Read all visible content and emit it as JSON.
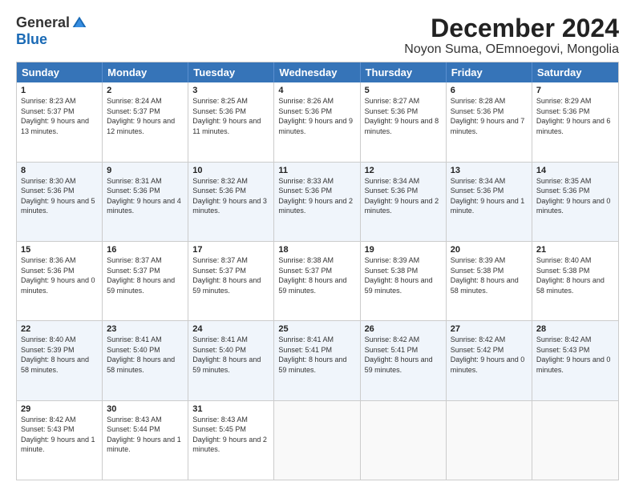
{
  "logo": {
    "general": "General",
    "blue": "Blue"
  },
  "title": "December 2024",
  "subtitle": "Noyon Suma, OEmnoegovi, Mongolia",
  "header_days": [
    "Sunday",
    "Monday",
    "Tuesday",
    "Wednesday",
    "Thursday",
    "Friday",
    "Saturday"
  ],
  "weeks": [
    [
      {
        "day": "1",
        "sunrise": "Sunrise: 8:23 AM",
        "sunset": "Sunset: 5:37 PM",
        "daylight": "Daylight: 9 hours and 13 minutes."
      },
      {
        "day": "2",
        "sunrise": "Sunrise: 8:24 AM",
        "sunset": "Sunset: 5:37 PM",
        "daylight": "Daylight: 9 hours and 12 minutes."
      },
      {
        "day": "3",
        "sunrise": "Sunrise: 8:25 AM",
        "sunset": "Sunset: 5:36 PM",
        "daylight": "Daylight: 9 hours and 11 minutes."
      },
      {
        "day": "4",
        "sunrise": "Sunrise: 8:26 AM",
        "sunset": "Sunset: 5:36 PM",
        "daylight": "Daylight: 9 hours and 9 minutes."
      },
      {
        "day": "5",
        "sunrise": "Sunrise: 8:27 AM",
        "sunset": "Sunset: 5:36 PM",
        "daylight": "Daylight: 9 hours and 8 minutes."
      },
      {
        "day": "6",
        "sunrise": "Sunrise: 8:28 AM",
        "sunset": "Sunset: 5:36 PM",
        "daylight": "Daylight: 9 hours and 7 minutes."
      },
      {
        "day": "7",
        "sunrise": "Sunrise: 8:29 AM",
        "sunset": "Sunset: 5:36 PM",
        "daylight": "Daylight: 9 hours and 6 minutes."
      }
    ],
    [
      {
        "day": "8",
        "sunrise": "Sunrise: 8:30 AM",
        "sunset": "Sunset: 5:36 PM",
        "daylight": "Daylight: 9 hours and 5 minutes."
      },
      {
        "day": "9",
        "sunrise": "Sunrise: 8:31 AM",
        "sunset": "Sunset: 5:36 PM",
        "daylight": "Daylight: 9 hours and 4 minutes."
      },
      {
        "day": "10",
        "sunrise": "Sunrise: 8:32 AM",
        "sunset": "Sunset: 5:36 PM",
        "daylight": "Daylight: 9 hours and 3 minutes."
      },
      {
        "day": "11",
        "sunrise": "Sunrise: 8:33 AM",
        "sunset": "Sunset: 5:36 PM",
        "daylight": "Daylight: 9 hours and 2 minutes."
      },
      {
        "day": "12",
        "sunrise": "Sunrise: 8:34 AM",
        "sunset": "Sunset: 5:36 PM",
        "daylight": "Daylight: 9 hours and 2 minutes."
      },
      {
        "day": "13",
        "sunrise": "Sunrise: 8:34 AM",
        "sunset": "Sunset: 5:36 PM",
        "daylight": "Daylight: 9 hours and 1 minute."
      },
      {
        "day": "14",
        "sunrise": "Sunrise: 8:35 AM",
        "sunset": "Sunset: 5:36 PM",
        "daylight": "Daylight: 9 hours and 0 minutes."
      }
    ],
    [
      {
        "day": "15",
        "sunrise": "Sunrise: 8:36 AM",
        "sunset": "Sunset: 5:36 PM",
        "daylight": "Daylight: 9 hours and 0 minutes."
      },
      {
        "day": "16",
        "sunrise": "Sunrise: 8:37 AM",
        "sunset": "Sunset: 5:37 PM",
        "daylight": "Daylight: 8 hours and 59 minutes."
      },
      {
        "day": "17",
        "sunrise": "Sunrise: 8:37 AM",
        "sunset": "Sunset: 5:37 PM",
        "daylight": "Daylight: 8 hours and 59 minutes."
      },
      {
        "day": "18",
        "sunrise": "Sunrise: 8:38 AM",
        "sunset": "Sunset: 5:37 PM",
        "daylight": "Daylight: 8 hours and 59 minutes."
      },
      {
        "day": "19",
        "sunrise": "Sunrise: 8:39 AM",
        "sunset": "Sunset: 5:38 PM",
        "daylight": "Daylight: 8 hours and 59 minutes."
      },
      {
        "day": "20",
        "sunrise": "Sunrise: 8:39 AM",
        "sunset": "Sunset: 5:38 PM",
        "daylight": "Daylight: 8 hours and 58 minutes."
      },
      {
        "day": "21",
        "sunrise": "Sunrise: 8:40 AM",
        "sunset": "Sunset: 5:38 PM",
        "daylight": "Daylight: 8 hours and 58 minutes."
      }
    ],
    [
      {
        "day": "22",
        "sunrise": "Sunrise: 8:40 AM",
        "sunset": "Sunset: 5:39 PM",
        "daylight": "Daylight: 8 hours and 58 minutes."
      },
      {
        "day": "23",
        "sunrise": "Sunrise: 8:41 AM",
        "sunset": "Sunset: 5:40 PM",
        "daylight": "Daylight: 8 hours and 58 minutes."
      },
      {
        "day": "24",
        "sunrise": "Sunrise: 8:41 AM",
        "sunset": "Sunset: 5:40 PM",
        "daylight": "Daylight: 8 hours and 59 minutes."
      },
      {
        "day": "25",
        "sunrise": "Sunrise: 8:41 AM",
        "sunset": "Sunset: 5:41 PM",
        "daylight": "Daylight: 8 hours and 59 minutes."
      },
      {
        "day": "26",
        "sunrise": "Sunrise: 8:42 AM",
        "sunset": "Sunset: 5:41 PM",
        "daylight": "Daylight: 8 hours and 59 minutes."
      },
      {
        "day": "27",
        "sunrise": "Sunrise: 8:42 AM",
        "sunset": "Sunset: 5:42 PM",
        "daylight": "Daylight: 9 hours and 0 minutes."
      },
      {
        "day": "28",
        "sunrise": "Sunrise: 8:42 AM",
        "sunset": "Sunset: 5:43 PM",
        "daylight": "Daylight: 9 hours and 0 minutes."
      }
    ],
    [
      {
        "day": "29",
        "sunrise": "Sunrise: 8:42 AM",
        "sunset": "Sunset: 5:43 PM",
        "daylight": "Daylight: 9 hours and 1 minute."
      },
      {
        "day": "30",
        "sunrise": "Sunrise: 8:43 AM",
        "sunset": "Sunset: 5:44 PM",
        "daylight": "Daylight: 9 hours and 1 minute."
      },
      {
        "day": "31",
        "sunrise": "Sunrise: 8:43 AM",
        "sunset": "Sunset: 5:45 PM",
        "daylight": "Daylight: 9 hours and 2 minutes."
      },
      null,
      null,
      null,
      null
    ]
  ]
}
